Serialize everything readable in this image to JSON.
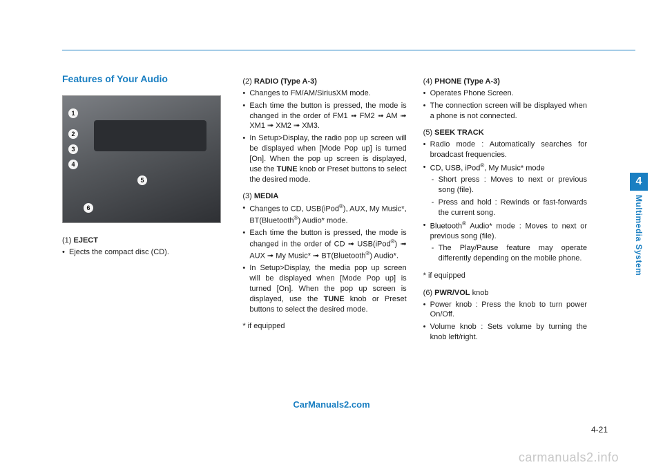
{
  "chapter": {
    "number": "4",
    "name": "Multimedia System"
  },
  "page_number": "4-21",
  "watermarks": {
    "center": "CarManuals2.com",
    "bottom": "carmanuals2.info"
  },
  "title": "Features of Your Audio",
  "photo_callouts": [
    "1",
    "2",
    "3",
    "4",
    "5",
    "6"
  ],
  "col1": {
    "s1": {
      "num": "(1)",
      "label": "EJECT",
      "b1": "Ejects the compact disc (CD)."
    }
  },
  "col2": {
    "s2": {
      "num": "(2)",
      "label": "RADIO (Type A-3)",
      "b1": "Changes to FM/AM/SiriusXM mode.",
      "b2": "Each time the button is pressed, the mode is changed in the order of FM1 ➟ FM2 ➟ AM ➟ XM1 ➟ XM2 ➟ XM3.",
      "b3_a": "In Setup>Display, the radio pop up screen will be displayed when [Mode Pop up] is turned [On]. When the pop up screen is displayed, use the ",
      "b3_b": "TUNE",
      "b3_c": " knob or Preset ",
      "b3_d": "buttons",
      "b3_e": " to select the desired mode."
    },
    "s3": {
      "num": "(3)",
      "label": "MEDIA",
      "b1_a": "Changes to CD, USB(iPod",
      "b1_b": "®",
      "b1_c": "), AUX, My Music*, BT(Bluetooth",
      "b1_d": "®",
      "b1_e": ") Audio* mode.",
      "b2_a": "Each time the button is pressed, the mode is changed in the order of CD ➟ USB(iPod",
      "b2_b": "®",
      "b2_c": ") ➟ AUX ➟ My Music* ➟ BT(Bluetooth",
      "b2_d": "®",
      "b2_e": ") Audio*.",
      "b3_a": "In Setup>Display, the media pop up screen will be displayed when [Mode Pop up] is turned [On]. When the pop up screen is displayed, use the ",
      "b3_b": "TUNE",
      "b3_c": " knob or Preset buttons to select the desired mode."
    },
    "footnote": "* if equipped"
  },
  "col3": {
    "s4": {
      "num": "(4)",
      "label_a": "PHONE",
      "label_b": " (Type A-3)",
      "b1": "Operates Phone Screen.",
      "b2": "The connection screen will be displayed when a phone is not connected."
    },
    "s5": {
      "num": "(5)",
      "label": "SEEK TRACK",
      "b1": "Radio mode : Automatically searches for broadcast frequencies.",
      "b2_a": "CD, USB, iPod",
      "b2_b": "®",
      "b2_c": ", My Music* mode",
      "b2_d1": "Short press : Moves to next or previous song (file).",
      "b2_d2": "Press and hold : Rewinds or fast-forwards the current song.",
      "b3_a": "Bluetooth",
      "b3_b": "®",
      "b3_c": " Audio* mode : Moves to next or previous song (file).",
      "b3_d1": "The Play/Pause feature may operate differently depending on the mobile phone."
    },
    "footnote": "* if equipped",
    "s6": {
      "num": "(6)",
      "label_a": "PWR/VOL",
      "label_b": " knob",
      "b1": "Power knob : Press the knob to turn power On/Off.",
      "b2": "Volume knob : Sets volume by turning the knob left/right."
    }
  }
}
